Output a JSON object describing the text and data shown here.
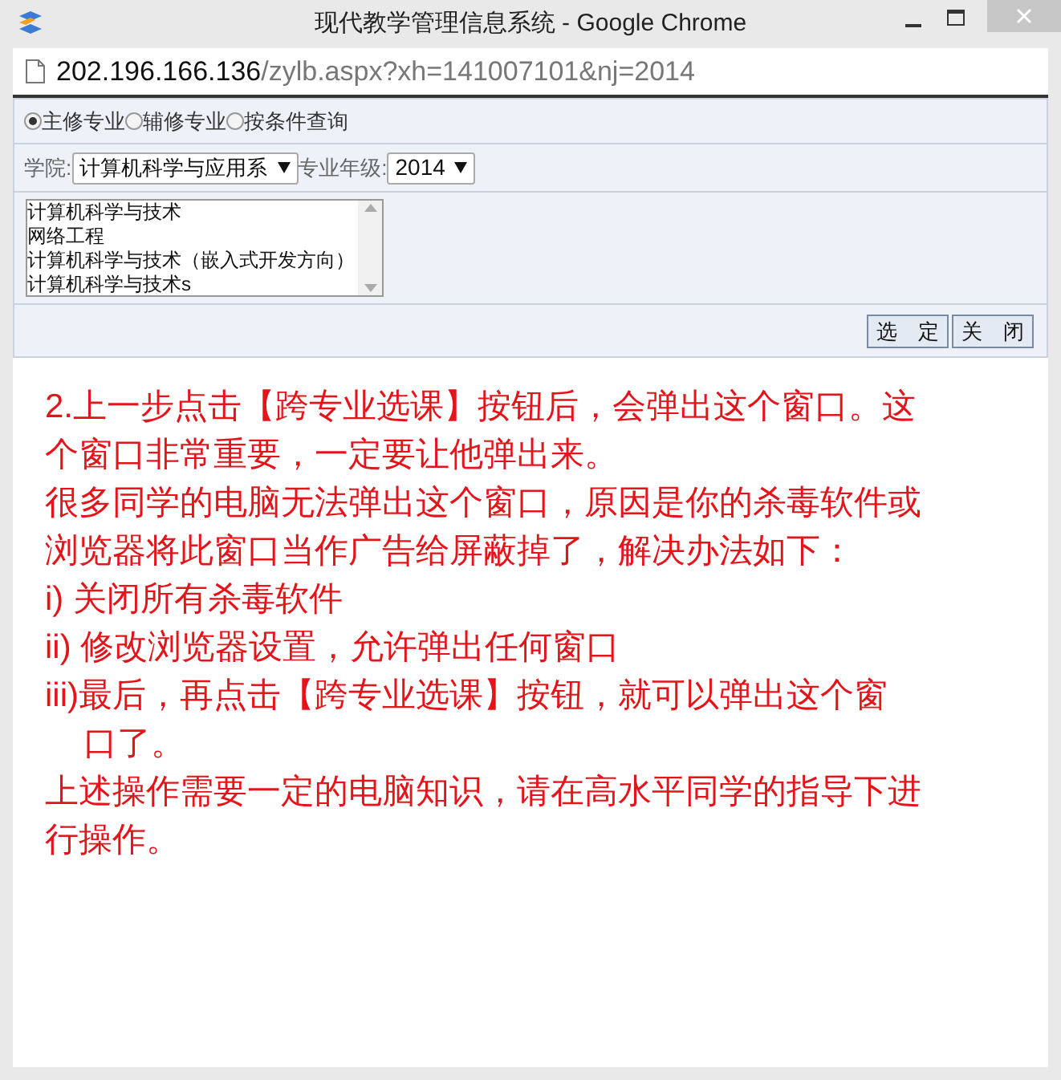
{
  "window": {
    "title": "现代教学管理信息系统 - Google Chrome"
  },
  "address_bar": {
    "host": "202.196.166.136",
    "path": "/zylb.aspx?xh=141007101&nj=2014"
  },
  "radios": [
    {
      "label": "主修专业",
      "selected": true
    },
    {
      "label": "辅修专业",
      "selected": false
    },
    {
      "label": "按条件查询",
      "selected": false
    }
  ],
  "filters": [
    {
      "label": "学院:",
      "value": "计算机科学与应用系"
    },
    {
      "label": "专业年级:",
      "value": "2014"
    }
  ],
  "majors": [
    "计算机科学与技术",
    "网络工程",
    "计算机科学与技术（嵌入式开发方向）",
    "计算机科学与技术s"
  ],
  "buttons": [
    "选　定",
    "关　闭"
  ],
  "instructions": [
    {
      "kind": "plain",
      "text": "2.上一步点击【跨专业选课】按钮后，会弹出这个窗口。这个窗口非常重要，一定要让他弹出来。"
    },
    {
      "kind": "plain",
      "text": "很多同学的电脑无法弹出这个窗口，原因是你的杀毒软件或浏览器将此窗口当作广告给屏蔽掉了，解决办法如下："
    },
    {
      "kind": "plain",
      "text": "i) 关闭所有杀毒软件"
    },
    {
      "kind": "plain",
      "text": "ii) 修改浏览器设置，允许弹出任何窗口"
    },
    {
      "kind": "hanging",
      "text": "iii)最后，再点击【跨专业选课】按钮，就可以弹出这个窗口了。"
    },
    {
      "kind": "plain",
      "text": "上述操作需要一定的电脑知识，请在高水平同学的指导下进行操作。"
    }
  ]
}
